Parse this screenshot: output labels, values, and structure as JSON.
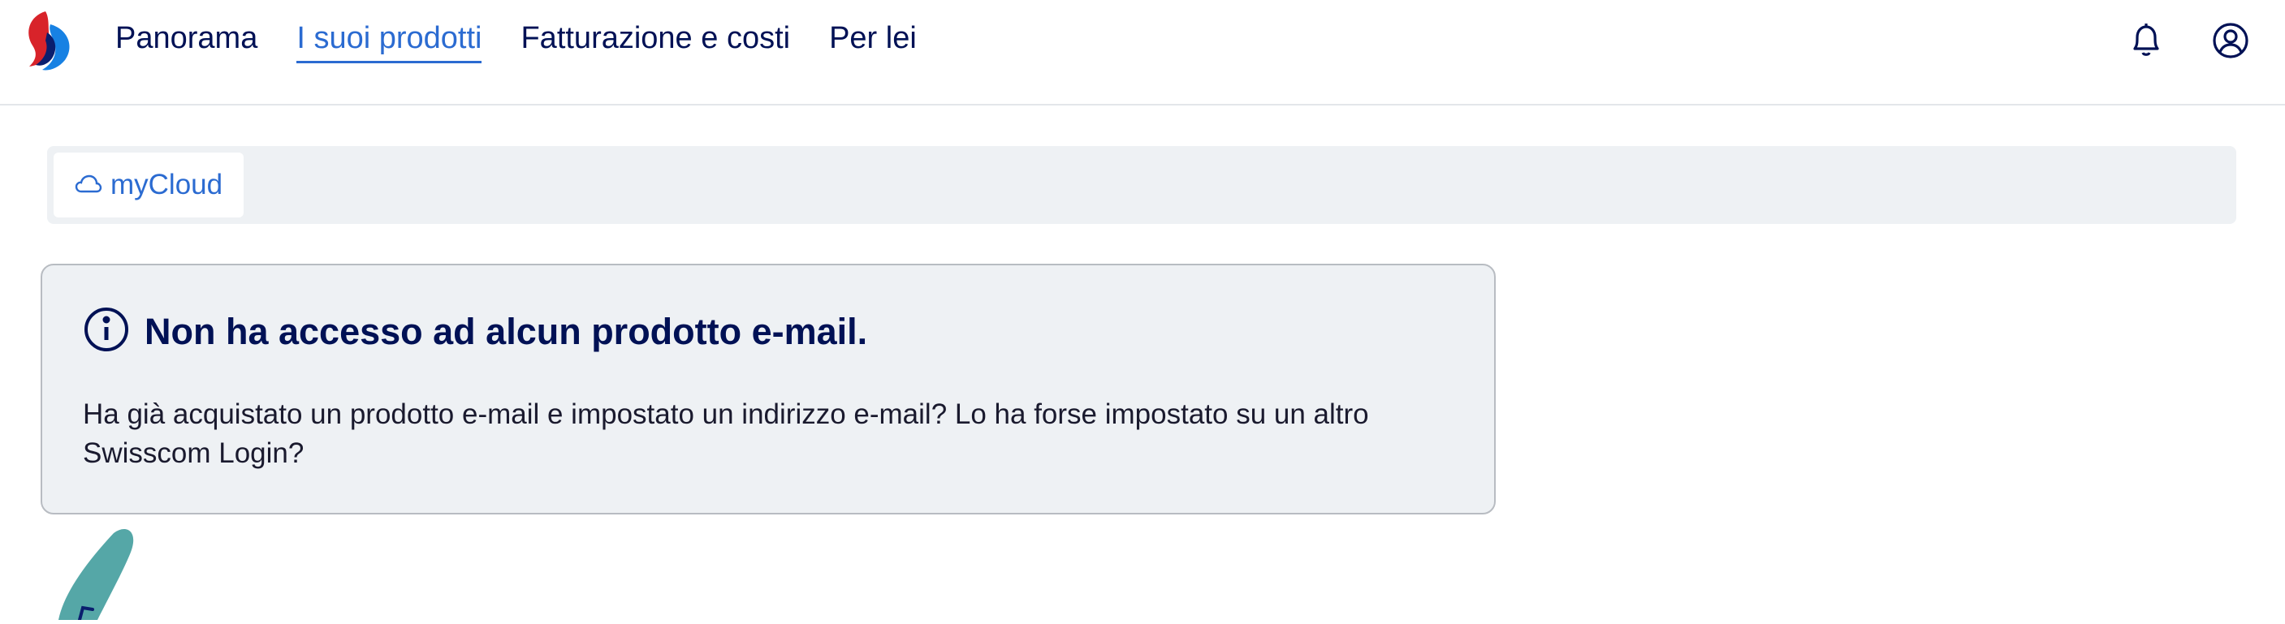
{
  "nav": {
    "items": [
      {
        "label": "Panorama",
        "active": false
      },
      {
        "label": "I suoi prodotti",
        "active": true
      },
      {
        "label": "Fatturazione e costi",
        "active": false
      },
      {
        "label": "Per lei",
        "active": false
      }
    ]
  },
  "header_icons": [
    "bell-icon",
    "user-icon"
  ],
  "subnav": {
    "tab_label": "myCloud",
    "tab_icon": "cloud-icon"
  },
  "info": {
    "icon": "info-icon",
    "title": "Non ha accesso ad alcun prodotto e-mail.",
    "text": "Ha già acquistato un prodotto e-mail e impostato un indirizzo e-mail? Lo ha forse impostato su un altro Swisscom Login?"
  },
  "colors": {
    "navy": "#001155",
    "accent": "#2b6bd1",
    "panel_bg": "#eef1f4",
    "teal": "#55a7a7"
  }
}
